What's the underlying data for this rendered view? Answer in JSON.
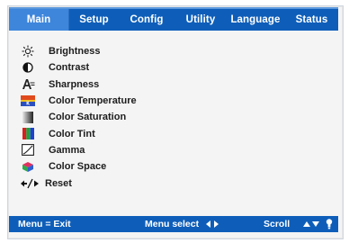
{
  "tabs": [
    {
      "label": "Main",
      "active": true
    },
    {
      "label": "Setup",
      "active": false
    },
    {
      "label": "Config",
      "active": false
    },
    {
      "label": "Utility",
      "active": false
    },
    {
      "label": "Language",
      "active": false
    },
    {
      "label": "Status",
      "active": false
    }
  ],
  "menu_items": [
    {
      "label": "Brightness",
      "icon": "brightness-sun-icon"
    },
    {
      "label": "Contrast",
      "icon": "contrast-icon"
    },
    {
      "label": "Sharpness",
      "icon": "sharpness-icon"
    },
    {
      "label": "Color Temperature",
      "icon": "color-temperature-icon"
    },
    {
      "label": "Color Saturation",
      "icon": "color-saturation-icon"
    },
    {
      "label": "Color Tint",
      "icon": "color-tint-icon"
    },
    {
      "label": "Gamma",
      "icon": "gamma-icon"
    },
    {
      "label": "Color Space",
      "icon": "color-space-icon"
    },
    {
      "label": "Reset",
      "icon": "reset-icon"
    }
  ],
  "footer": {
    "exit": "Menu = Exit",
    "select": "Menu select",
    "scroll": "Scroll"
  },
  "colors": {
    "bar_blue": "#0e5eb9",
    "active_tab": "#3d86dc"
  }
}
